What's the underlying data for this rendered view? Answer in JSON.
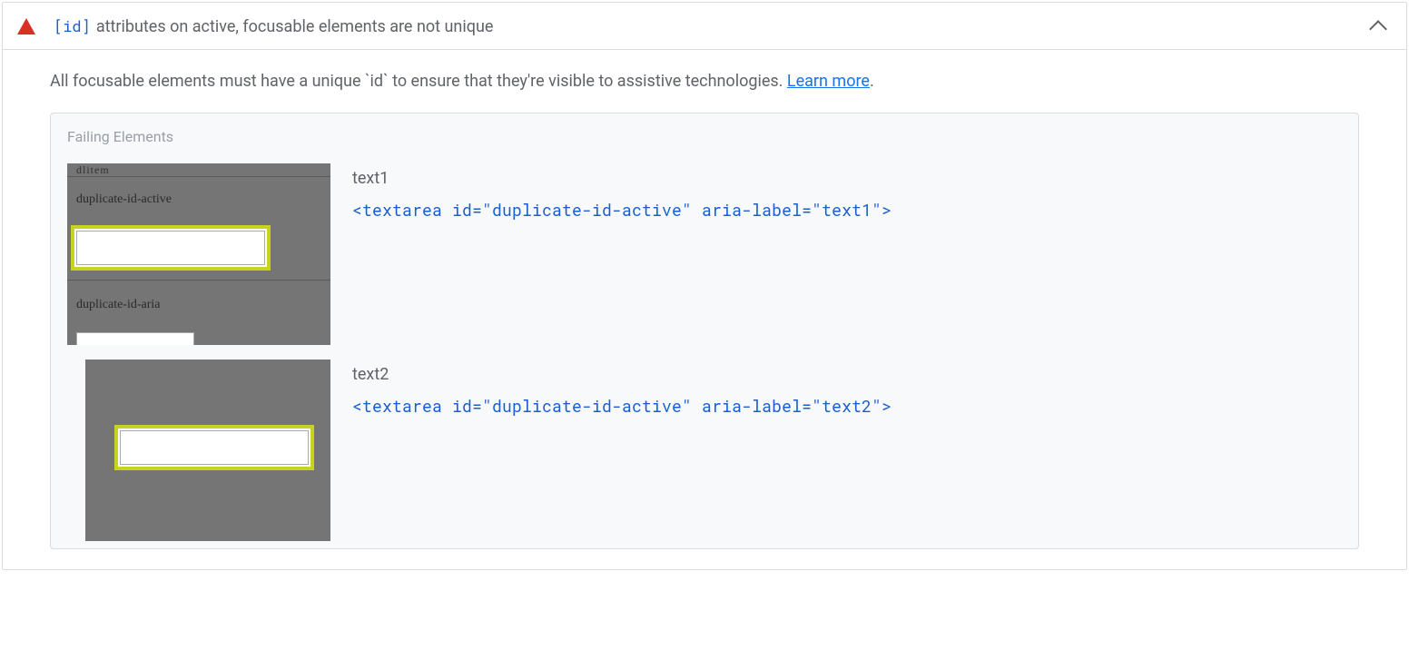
{
  "header": {
    "code_badge": "[id]",
    "title": "attributes on active, focusable elements are not unique"
  },
  "description": {
    "text": "All focusable elements must have a unique `id` to ensure that they're visible to assistive technologies. ",
    "learn_more": "Learn more",
    "period": "."
  },
  "panel": {
    "title": "Failing Elements",
    "items": [
      {
        "label": "text1",
        "snippet": "<textarea id=\"duplicate-id-active\" aria-label=\"text1\">",
        "thumb": {
          "top_cut": "dlitem",
          "label_mid": "duplicate-id-active",
          "label_bot": "duplicate-id-aria"
        }
      },
      {
        "label": "text2",
        "snippet": "<textarea id=\"duplicate-id-active\" aria-label=\"text2\">"
      }
    ]
  }
}
